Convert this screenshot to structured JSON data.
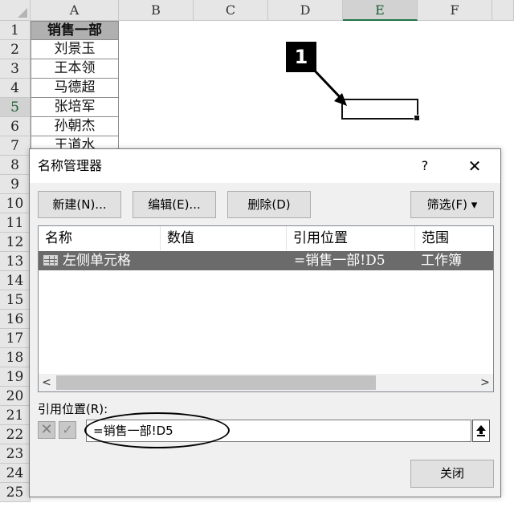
{
  "sheet": {
    "columns": [
      "A",
      "B",
      "C",
      "D",
      "E",
      "F"
    ],
    "active_column": "E",
    "rows": [
      "1",
      "2",
      "3",
      "4",
      "5",
      "6",
      "7",
      "8",
      "9",
      "10",
      "11",
      "12",
      "13",
      "14",
      "15",
      "16",
      "17",
      "18",
      "19",
      "20",
      "21",
      "22",
      "23",
      "24",
      "25"
    ],
    "active_row": "5",
    "colA_cells": [
      "销售一部",
      "刘景玉",
      "王本领",
      "马德超",
      "张培军",
      "孙朝杰",
      "王道水"
    ],
    "badge_number": "1",
    "selected_cell": "E5"
  },
  "dialog": {
    "title": "名称管理器",
    "help_label": "?",
    "close_label": "✕",
    "buttons": {
      "new": "新建(N)...",
      "edit": "编辑(E)...",
      "delete": "删除(D)",
      "filter": "筛选(F) ▾",
      "close": "关闭"
    },
    "list": {
      "columns": [
        "名称",
        "数值",
        "引用位置",
        "范围"
      ],
      "rows": [
        {
          "name": "左侧单元格",
          "value": "",
          "refers_to": "=销售一部!D5",
          "scope": "工作簿"
        }
      ]
    },
    "scrollbar": {
      "left_arrow": "<",
      "right_arrow": ">"
    },
    "refers_to_label": "引用位置(R):",
    "refers_to_value": "=销售一部!D5",
    "cancel_icon": "✕",
    "confirm_icon": "✓"
  },
  "colors": {
    "selection_bg": "#6b6b6b",
    "header_fill": "#b0b0b0",
    "active_header_accent": "#217346"
  }
}
